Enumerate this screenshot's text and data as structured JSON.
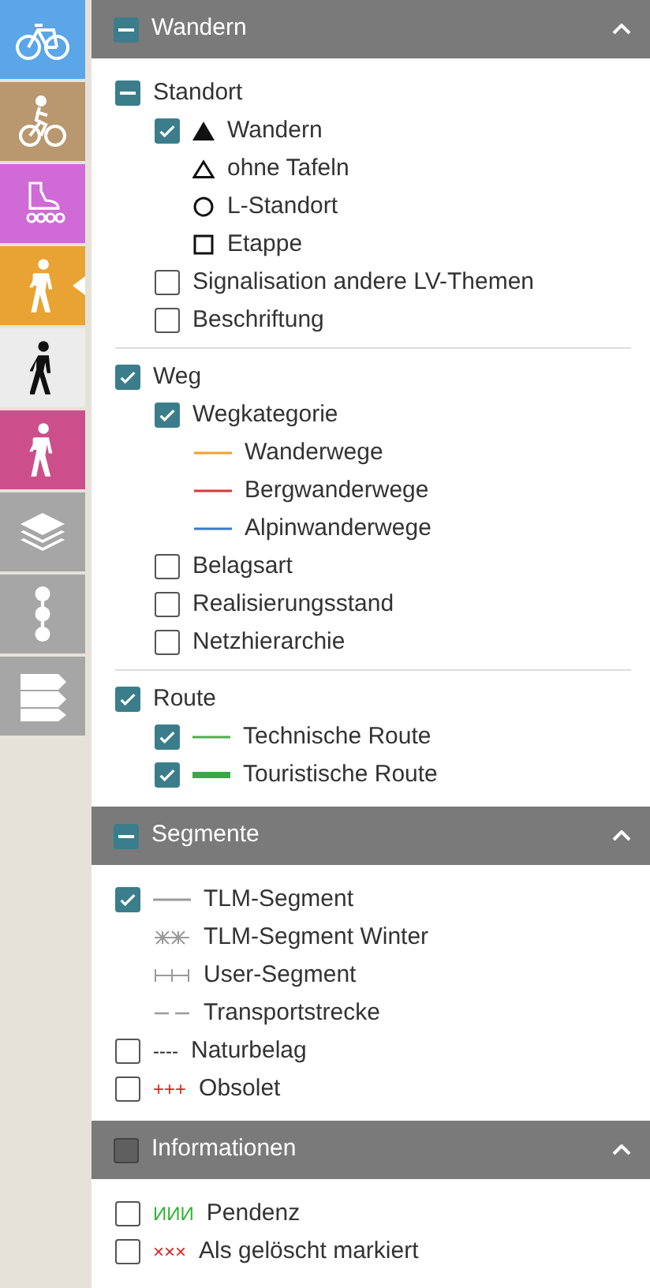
{
  "rail": [
    {
      "kind": "bicycle",
      "color": "#5aa6e8",
      "selected": false
    },
    {
      "kind": "cyclist",
      "color": "#b9976f",
      "selected": false
    },
    {
      "kind": "skate",
      "color": "#cf6ad6",
      "selected": false
    },
    {
      "kind": "hiker",
      "color": "#e9a332",
      "selected": true
    },
    {
      "kind": "walker",
      "color": "#ececec",
      "selected": false
    },
    {
      "kind": "hiker",
      "color": "#cc4f8c",
      "selected": false
    },
    {
      "kind": "layers",
      "color": "#a6a6a6",
      "selected": false
    },
    {
      "kind": "dots",
      "color": "#a6a6a6",
      "selected": false
    },
    {
      "kind": "signs",
      "color": "#a6a6a6",
      "selected": false
    }
  ],
  "sections": [
    {
      "title": "Wandern",
      "kind": "mixed",
      "expanded": true,
      "groups": [
        [
          {
            "label": "Standort",
            "kind": "mixed",
            "children": [
              {
                "label": "Wandern",
                "kind": "checkbox",
                "checked": true,
                "symbol": {
                  "kind": "triangle-filled"
                }
              },
              {
                "label": "ohne Tafeln",
                "kind": "legend",
                "symbol": {
                  "kind": "triangle"
                }
              },
              {
                "label": "L-Standort",
                "kind": "legend",
                "symbol": {
                  "kind": "circle"
                }
              },
              {
                "label": "Etappe",
                "kind": "legend",
                "symbol": {
                  "kind": "square"
                }
              },
              {
                "label": "Signalisation andere LV-Themen",
                "kind": "checkbox",
                "checked": false
              },
              {
                "label": "Beschriftung",
                "kind": "checkbox",
                "checked": false
              }
            ]
          }
        ],
        [
          {
            "label": "Weg",
            "kind": "checkbox",
            "checked": true,
            "children": [
              {
                "label": "Wegkategorie",
                "kind": "checkbox",
                "checked": true,
                "children": [
                  {
                    "label": "Wanderwege",
                    "symbol": {
                      "kind": "line",
                      "color": "#f0a030"
                    }
                  },
                  {
                    "label": "Bergwanderwege",
                    "symbol": {
                      "kind": "line",
                      "color": "#d83838"
                    }
                  },
                  {
                    "label": "Alpinwanderwege",
                    "symbol": {
                      "kind": "line",
                      "color": "#3a78c8"
                    }
                  }
                ]
              },
              {
                "label": "Belagsart",
                "kind": "checkbox",
                "checked": false
              },
              {
                "label": "Realisierungsstand",
                "kind": "checkbox",
                "checked": false
              },
              {
                "label": "Netzhierarchie",
                "kind": "checkbox",
                "checked": false
              }
            ]
          }
        ],
        [
          {
            "label": "Route",
            "kind": "checkbox",
            "checked": true,
            "children": [
              {
                "label": "Technische Route",
                "kind": "checkbox",
                "checked": true,
                "symbol": {
                  "kind": "line",
                  "color": "#4caf50"
                }
              },
              {
                "label": "Touristische Route",
                "kind": "checkbox",
                "checked": true,
                "symbol": {
                  "kind": "thick-line",
                  "color": "#3aa84a"
                }
              }
            ]
          }
        ]
      ]
    },
    {
      "title": "Segmente",
      "kind": "mixed",
      "expanded": true,
      "groups": [
        [
          {
            "label": "TLM-Segment",
            "kind": "checkbox",
            "checked": true,
            "symbol": {
              "kind": "line",
              "color": "#9a9a9a"
            }
          },
          {
            "label": "TLM-Segment Winter",
            "kind": "legend",
            "symbol": {
              "kind": "star-line",
              "color": "#9a9a9a"
            }
          },
          {
            "label": "User-Segment",
            "kind": "legend",
            "symbol": {
              "kind": "tick-line",
              "color": "#9a9a9a"
            }
          },
          {
            "label": "Transportstrecke",
            "kind": "legend",
            "symbol": {
              "kind": "dash-line",
              "color": "#9a9a9a"
            }
          },
          {
            "label": "Naturbelag",
            "kind": "checkbox",
            "checked": false,
            "symbol": {
              "kind": "text",
              "mark": "----",
              "color": "#222222"
            }
          },
          {
            "label": "Obsolet",
            "kind": "checkbox",
            "checked": false,
            "symbol": {
              "kind": "text",
              "mark": "+++",
              "color": "#e02020"
            }
          }
        ]
      ]
    },
    {
      "title": "Informationen",
      "kind": "checkbox",
      "checked": false,
      "expanded": true,
      "groups": [
        [
          {
            "label": "Pendenz",
            "kind": "checkbox",
            "checked": false,
            "symbol": {
              "kind": "text",
              "mark": "ИИИ",
              "color": "#33b233"
            }
          },
          {
            "label": "Als gelöscht markiert",
            "kind": "checkbox",
            "checked": false,
            "symbol": {
              "kind": "text",
              "mark": "×××",
              "color": "#e02020"
            }
          }
        ]
      ]
    }
  ]
}
